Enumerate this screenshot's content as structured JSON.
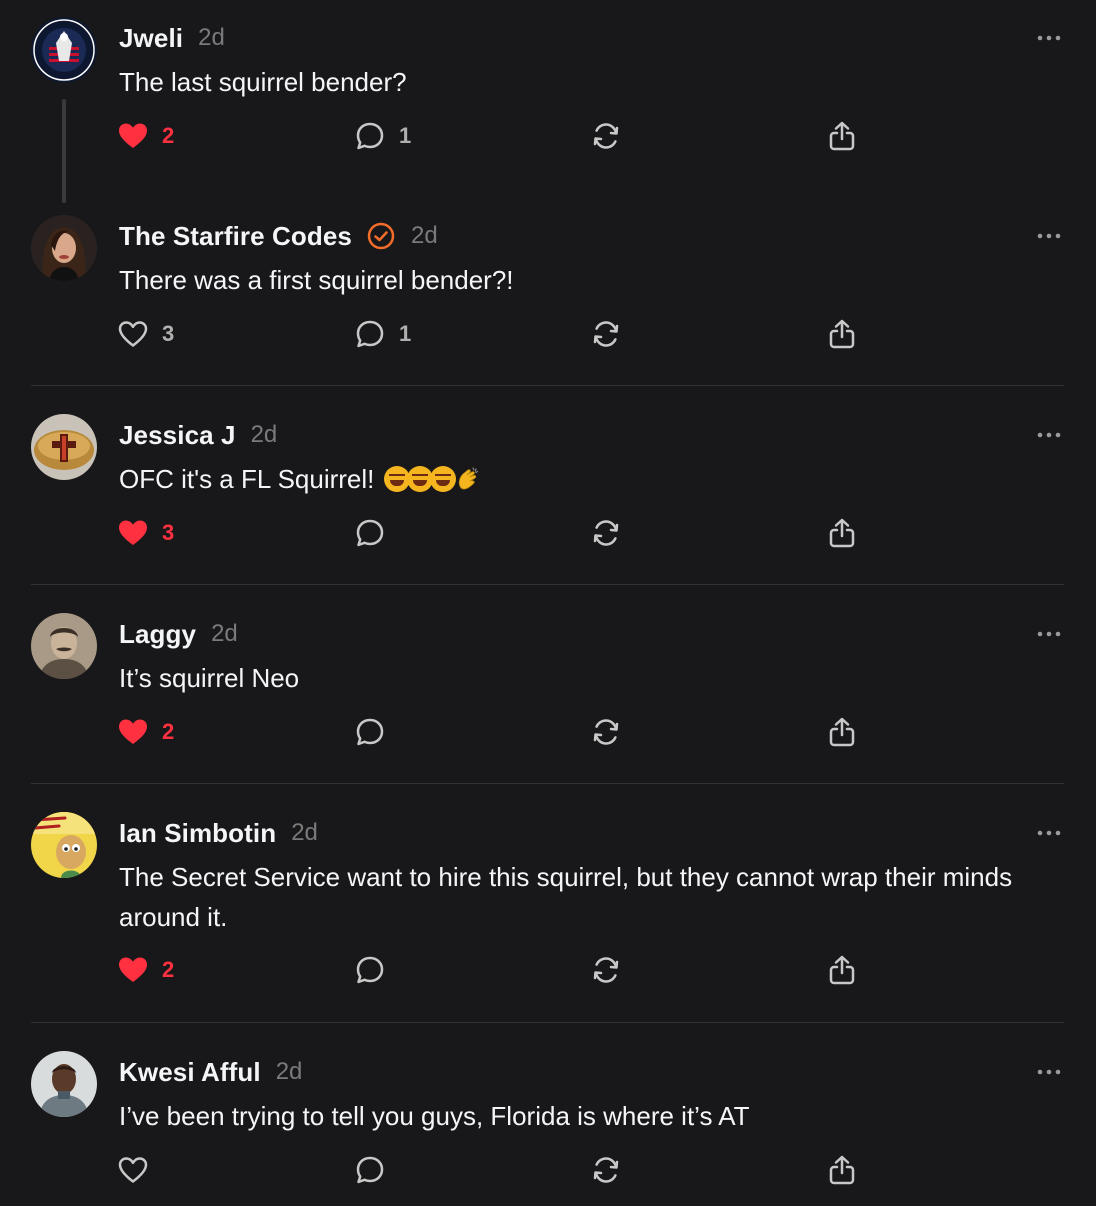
{
  "posts": [
    {
      "username": "Jweli",
      "time": "2d",
      "text": "The last squirrel bender?",
      "verified": false,
      "liked": true,
      "likes": "2",
      "replies": "1",
      "avatar_icon": "eagle-flag-badge-icon"
    },
    {
      "username": "The Starfire Codes",
      "time": "2d",
      "text": "There was a first squirrel bender?!",
      "verified": true,
      "liked": false,
      "likes": "3",
      "replies": "1",
      "avatar_icon": "woman-portrait-icon"
    },
    {
      "username": "Jessica J",
      "time": "2d",
      "text": "OFC it's a FL Squirrel!",
      "emojis": [
        "rofl-emoji-icon",
        "rofl-emoji-icon",
        "rofl-emoji-icon",
        "clap-emoji-icon"
      ],
      "verified": false,
      "liked": true,
      "likes": "3",
      "replies": "",
      "avatar_icon": "cross-ring-icon"
    },
    {
      "username": "Laggy",
      "time": "2d",
      "text": "It’s squirrel Neo",
      "verified": false,
      "liked": true,
      "likes": "2",
      "replies": "",
      "avatar_icon": "vintage-portrait-icon"
    },
    {
      "username": "Ian Simbotin",
      "time": "2d",
      "text": "The Secret Service want to hire this squirrel, but they cannot wrap their minds around it.",
      "verified": false,
      "liked": true,
      "likes": "2",
      "replies": "",
      "avatar_icon": "cartoon-avatar-icon"
    },
    {
      "username": "Kwesi Afful",
      "time": "2d",
      "text": "I’ve been trying to tell you guys, Florida is where it’s AT",
      "verified": false,
      "liked": false,
      "likes": "",
      "replies": "",
      "avatar_icon": "man-portrait-icon"
    }
  ],
  "colors": {
    "background": "#18181a",
    "like_active": "#ff3040",
    "verified": "#f26c2a",
    "muted": "#7a7a7a"
  }
}
